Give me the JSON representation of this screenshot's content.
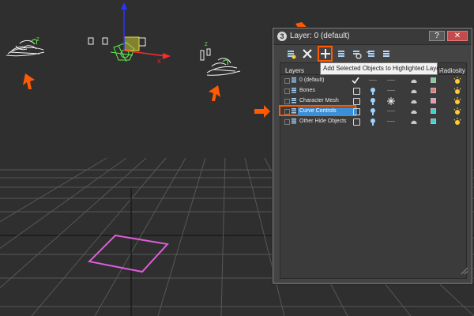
{
  "dialog": {
    "title": "Layer: 0 (default)",
    "help_label": "?",
    "close_label": "✕"
  },
  "toolbar": {
    "tools": [
      "create-new-layer-icon",
      "delete-layer-icon",
      "add-selected-to-layer-icon",
      "select-objects-in-layer-icon",
      "highlight-selected-layer-icon",
      "hide-unhide-all-icon",
      "freeze-unfreeze-all-icon"
    ],
    "tooltip": "Add Selected Objects to Highlighted Layer"
  },
  "panel": {
    "header": {
      "layers": "Layers",
      "radiosity": "Radiosity"
    },
    "rows": [
      {
        "label": "0 (default)",
        "hide_icon": "checkmark-icon",
        "swatch": "#7fd0a0",
        "selected": false
      },
      {
        "label": "Bones",
        "hide_icon": "lightbulb-icon",
        "swatch": "#e17a7a",
        "selected": false
      },
      {
        "label": "Character Mesh",
        "hide_icon": "lightbulb-icon",
        "swatch": "#e49ab5",
        "selected": false
      },
      {
        "label": "Curve Controls",
        "hide_icon": "lightbulb-icon",
        "swatch": "#3fd1cf",
        "selected": true
      },
      {
        "label": "Other Hide Objects",
        "hide_icon": "lightbulb-icon",
        "swatch": "#3fd1cf",
        "selected": false
      }
    ]
  },
  "colors": {
    "accent_orange": "#ff5a00",
    "selection_blue": "#3b8ed8",
    "viewport_bg": "#2f2f2f",
    "square_magenta": "#e05cdc"
  }
}
